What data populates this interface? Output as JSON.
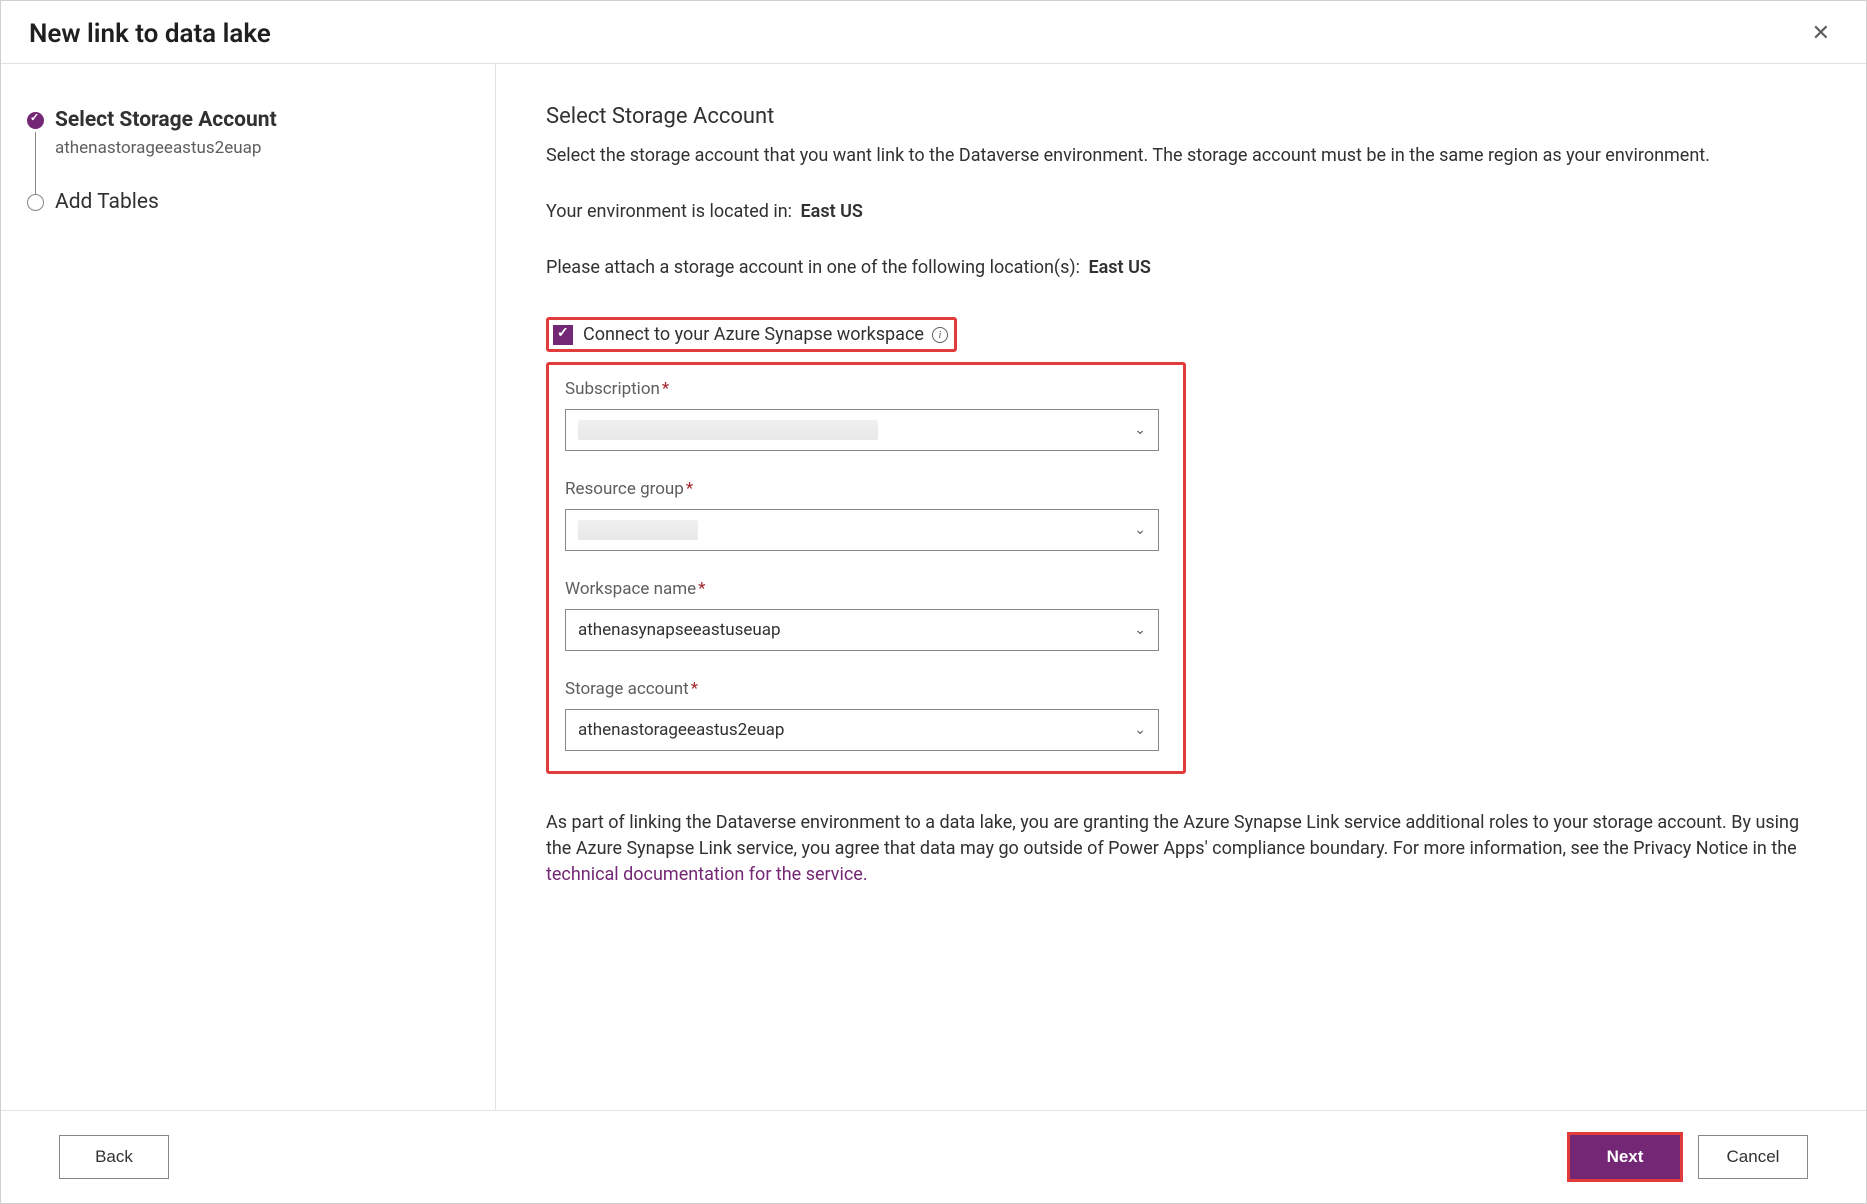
{
  "dialog": {
    "title": "New link to data lake"
  },
  "sidebar": {
    "steps": [
      {
        "title": "Select Storage Account",
        "sub": "athenastorageeastus2euap"
      },
      {
        "title": "Add Tables",
        "sub": ""
      }
    ]
  },
  "main": {
    "heading": "Select Storage Account",
    "description": "Select the storage account that you want link to the Dataverse environment. The storage account must be in the same region as your environment.",
    "env_prefix": "Your environment is located in:",
    "env_region": "East US",
    "attach_prefix": "Please attach a storage account in one of the following location(s):",
    "attach_region": "East US",
    "checkbox_label": "Connect to your Azure Synapse workspace",
    "fields": {
      "subscription": {
        "label": "Subscription",
        "value": ""
      },
      "resource_group": {
        "label": "Resource group",
        "value": ""
      },
      "workspace_name": {
        "label": "Workspace name",
        "value": "athenasynapseeastuseuap"
      },
      "storage_account": {
        "label": "Storage account",
        "value": "athenastorageeastus2euap"
      }
    },
    "footnote_pre": "As part of linking the Dataverse environment to a data lake, you are granting the Azure Synapse Link service additional roles to your storage account. By using the Azure Synapse Link service, you agree that data may go outside of Power Apps' compliance boundary. For more information, see the Privacy Notice in the ",
    "footnote_link": "technical documentation for the service.",
    "footnote_post": ""
  },
  "footer": {
    "back": "Back",
    "next": "Next",
    "cancel": "Cancel"
  }
}
